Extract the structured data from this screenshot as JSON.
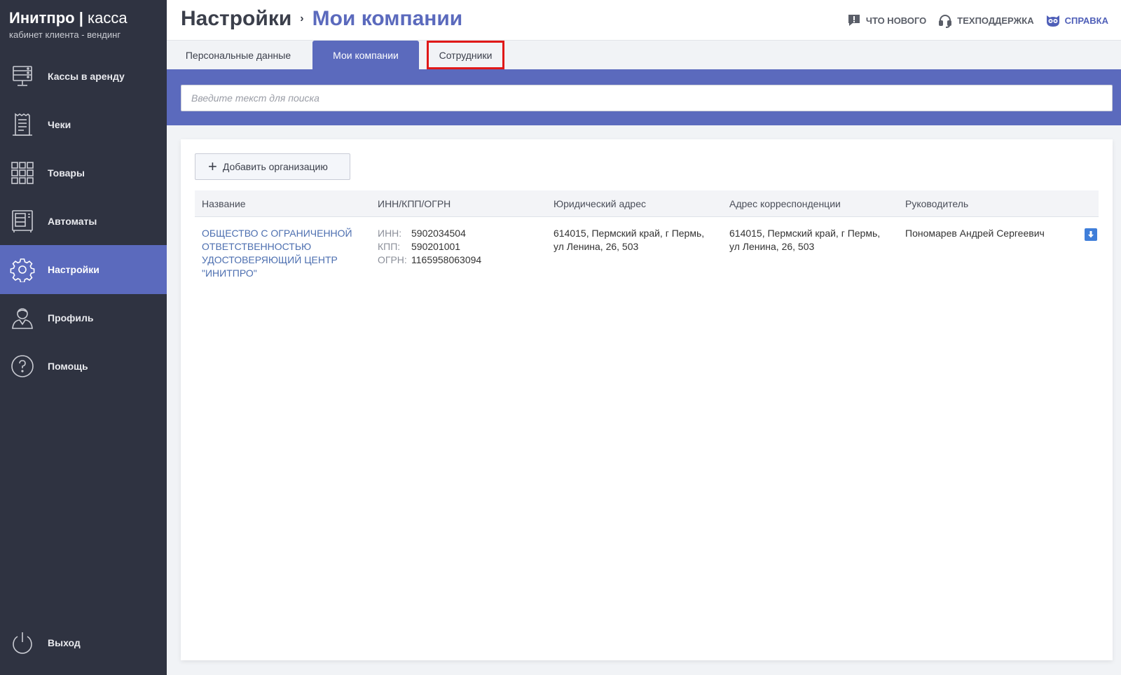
{
  "brand": {
    "name_bold": "Инитпро",
    "separator": "|",
    "name_light": "касса",
    "subtitle": "кабинет клиента - вендинг"
  },
  "sidebar": {
    "items": [
      {
        "label": "Кассы в аренду",
        "icon": "cash-register-icon",
        "active": false
      },
      {
        "label": "Чеки",
        "icon": "receipt-icon",
        "active": false
      },
      {
        "label": "Товары",
        "icon": "grid-icon",
        "active": false
      },
      {
        "label": "Автоматы",
        "icon": "vending-machine-icon",
        "active": false
      },
      {
        "label": "Настройки",
        "icon": "gear-icon",
        "active": true
      },
      {
        "label": "Профиль",
        "icon": "user-icon",
        "active": false
      },
      {
        "label": "Помощь",
        "icon": "help-circle-icon",
        "active": false
      }
    ],
    "logout": {
      "label": "Выход",
      "icon": "power-icon"
    }
  },
  "header": {
    "breadcrumb_root": "Настройки",
    "breadcrumb_arrow": "›",
    "breadcrumb_current": "Мои компании",
    "links": {
      "whats_new": "ЧТО НОВОГО",
      "support": "ТЕХПОДДЕРЖКА",
      "help": "СПРАВКА"
    }
  },
  "tabs": {
    "personal": "Персональные данные",
    "companies": "Мои компании",
    "employees": "Сотрудники"
  },
  "search": {
    "placeholder": "Введите текст для поиска",
    "value": ""
  },
  "main": {
    "add_button_label": "Добавить организацию",
    "columns": [
      "Название",
      "ИНН/КПП/ОГРН",
      "Юридический адрес",
      "Адрес корреспонденции",
      "Руководитель"
    ],
    "rows": [
      {
        "name": "ОБЩЕСТВО С ОГРАНИЧЕННОЙ ОТВЕТСТВЕННОСТЬЮ УДОСТОВЕРЯЮЩИЙ ЦЕНТР \"ИНИТПРО\"",
        "inn_label": "ИНН:",
        "inn": "5902034504",
        "kpp_label": "КПП:",
        "kpp": "590201001",
        "ogrn_label": "ОГРН:",
        "ogrn": "1165958063094",
        "legal_address": "614015, Пермский край, г Пермь, ул Ленина, 26, 503",
        "mail_address": "614015, Пермский край, г Пермь, ул Ленина, 26, 503",
        "director": "Пономарев Андрей Сергеевич"
      }
    ]
  },
  "colors": {
    "sidebar_bg": "#2f3341",
    "accent": "#5b6abd",
    "link": "#4d6fb0",
    "highlight_border": "#e01818",
    "download_button": "#3f7ed9"
  }
}
